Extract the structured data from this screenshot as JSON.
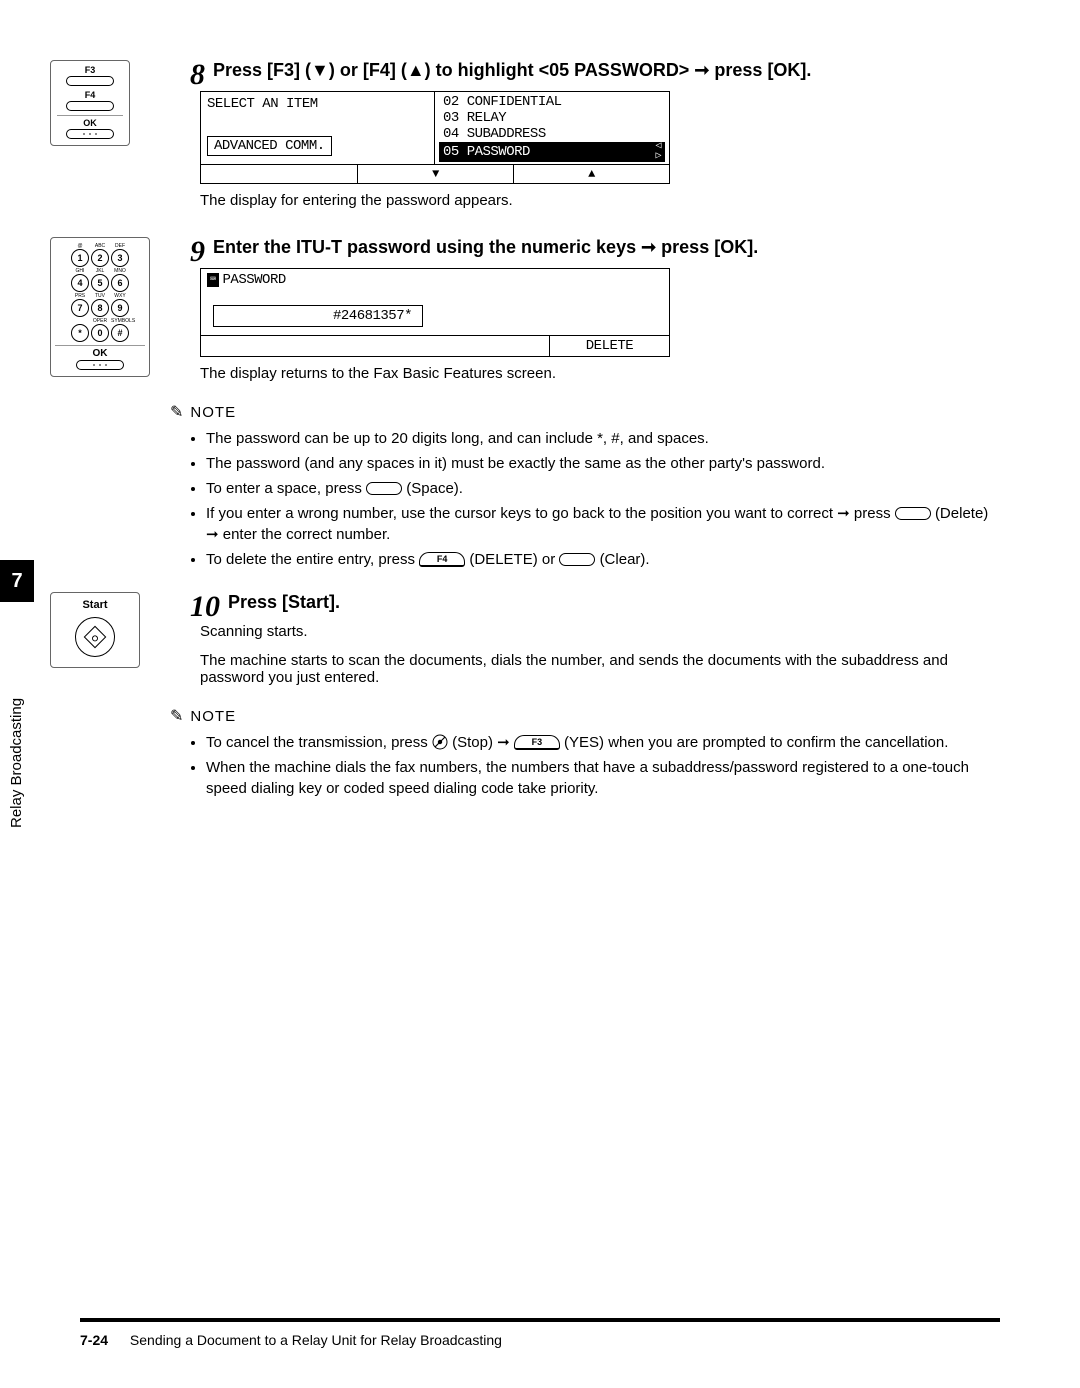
{
  "sideTab": "7",
  "sideText": "Relay Broadcasting",
  "buttonStack": {
    "f3": "F3",
    "f4": "F4",
    "ok": "OK"
  },
  "keypad": {
    "keys": [
      [
        {
          "n": "1",
          "s": "@"
        },
        {
          "n": "2",
          "s": "ABC"
        },
        {
          "n": "3",
          "s": "DEF"
        }
      ],
      [
        {
          "n": "4",
          "s": "GHI"
        },
        {
          "n": "5",
          "s": "JKL"
        },
        {
          "n": "6",
          "s": "MNO"
        }
      ],
      [
        {
          "n": "7",
          "s": "PRS"
        },
        {
          "n": "8",
          "s": "TUV"
        },
        {
          "n": "9",
          "s": "WXY"
        }
      ],
      [
        {
          "n": "*",
          "s": ""
        },
        {
          "n": "0",
          "s": "OPER"
        },
        {
          "n": "#",
          "s": "SYMBOLS"
        }
      ]
    ],
    "ok": "OK"
  },
  "startPanel": {
    "label": "Start"
  },
  "step8": {
    "num": "8",
    "head": "Press [F3] (▼) or [F4] (▲) to highlight <05 PASSWORD> ➞ press [OK].",
    "lcd": {
      "leftTitle": "SELECT AN ITEM",
      "leftBox": "ADVANCED COMM.",
      "options": [
        "02 CONFIDENTIAL",
        "03 RELAY",
        "04 SUBADDRESS",
        "05 PASSWORD"
      ],
      "down": "▼",
      "up": "▲"
    },
    "caption": "The display for entering the password appears."
  },
  "step9": {
    "num": "9",
    "head": "Enter the ITU-T password using the numeric keys ➞ press [OK].",
    "lcd": {
      "header": "PASSWORD",
      "value": "#24681357*",
      "delete": "DELETE"
    },
    "caption": "The display returns to the Fax Basic Features screen.",
    "noteLabel": "NOTE",
    "notes": [
      "The password can be up to 20 digits long, and can include *, #, and spaces.",
      "The password (and any spaces in it) must be exactly the same as the other party's password.",
      "To enter a space, press",
      "(Space).",
      "If you enter a wrong number, use the cursor keys to go back to the position you want to correct ➞ press",
      "(Delete) ➞ enter the correct number.",
      "To delete the entire entry, press",
      "(DELETE) or",
      "(Clear)."
    ],
    "f4": "F4"
  },
  "step10": {
    "num": "10",
    "head": "Press [Start].",
    "caption1": "Scanning starts.",
    "caption2": "The machine starts to scan the documents, dials the number, and sends the documents with the subaddress and password you just entered.",
    "noteLabel": "NOTE",
    "note1a": "To cancel the transmission, press",
    "note1b": "(Stop) ➞",
    "note1c": "(YES) when you are prompted to confirm the cancellation.",
    "f3": "F3",
    "note2": "When the machine dials the fax numbers, the numbers that have a subaddress/password registered to a one-touch speed dialing key or coded speed dialing code take priority."
  },
  "footer": {
    "page": "7-24",
    "text": "Sending a Document to a Relay Unit for Relay Broadcasting"
  }
}
